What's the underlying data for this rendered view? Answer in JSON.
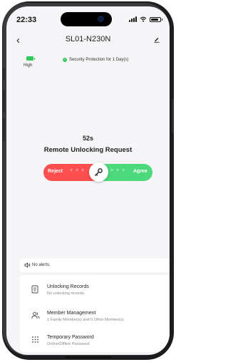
{
  "status_bar": {
    "time": "22:33"
  },
  "nav": {
    "back_icon": "chevron-left-icon",
    "title": "SL01-N230N",
    "edit_icon": "pencil-icon"
  },
  "info": {
    "battery_label": "High",
    "security_text": "Security Protection for 1 Day(s)"
  },
  "request": {
    "countdown": "52s",
    "title": "Remote Unlocking Request",
    "reject_label": "Reject",
    "agree_label": "Agree",
    "left_chevrons": "< < <",
    "right_chevrons": "> > >"
  },
  "alerts": {
    "text": "No alerts."
  },
  "menu": [
    {
      "title": "Unlocking Records",
      "subtitle": "No unlocking records.",
      "icon": "list-icon"
    },
    {
      "title": "Member Management",
      "subtitle": "1 Family Member(s) and 0 Other Member(s)",
      "icon": "members-icon"
    },
    {
      "title": "Temporary Password",
      "subtitle": "Online/Offline Password",
      "icon": "keypad-icon"
    }
  ],
  "colors": {
    "reject": "#ff4e4e",
    "agree": "#4cd97b",
    "success": "#34c759",
    "background": "#f5f5f7"
  }
}
